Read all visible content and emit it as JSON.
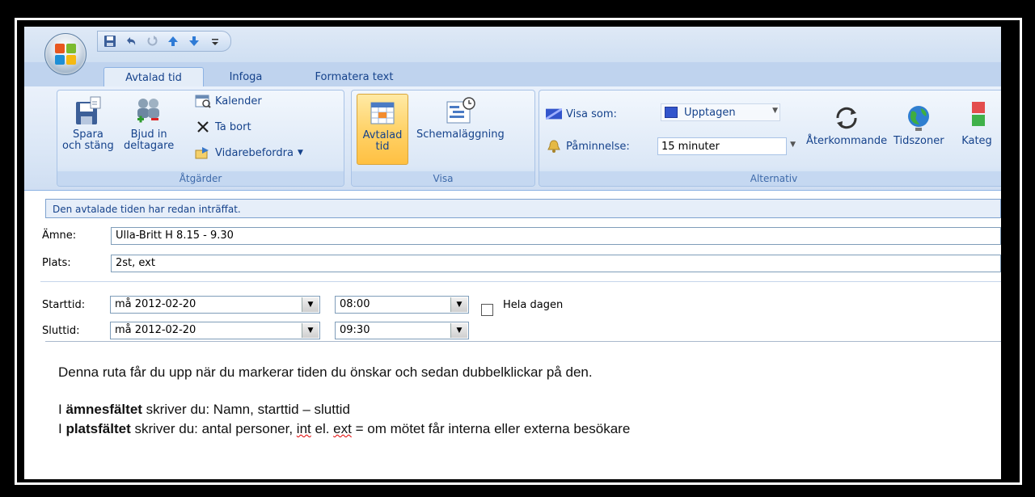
{
  "ribbon": {
    "tabs": [
      "Avtalad tid",
      "Infoga",
      "Formatera text"
    ],
    "groups": {
      "atgarder": {
        "label": "Åtgärder",
        "spara_line1": "Spara",
        "spara_line2": "och stäng",
        "bjud_line1": "Bjud in",
        "bjud_line2": "deltagare",
        "kalender": "Kalender",
        "ta_bort": "Ta bort",
        "vidarebefordra": "Vidarebefordra"
      },
      "visa": {
        "label": "Visa",
        "avtalad_line1": "Avtalad",
        "avtalad_line2": "tid",
        "schemalaggning": "Schemaläggning"
      },
      "alternativ": {
        "label": "Alternativ",
        "visa_som_label": "Visa som:",
        "visa_som_value": "Upptagen",
        "paminnelse_label": "Påminnelse:",
        "paminnelse_value": "15 minuter",
        "aterkommande": "Återkommande",
        "tidszoner": "Tidszoner",
        "kategorisera": "Kateg"
      }
    }
  },
  "form": {
    "info": "Den avtalade tiden har redan inträffat.",
    "amne_label": "Ämne:",
    "amne_value": "Ulla-Britt H 8.15 - 9.30",
    "plats_label": "Plats:",
    "plats_value": "2st, ext",
    "starttid_label": "Starttid:",
    "start_date": "må 2012-02-20",
    "start_time": "08:00",
    "hela_dagen": "Hela dagen",
    "sluttid_label": "Sluttid:",
    "end_date": "må 2012-02-20",
    "end_time": "09:30"
  },
  "body": {
    "line1": "Denna ruta får du upp när du markerar tiden du önskar och sedan dubbelklickar på den.",
    "line2_prefix": "I ",
    "line2_bold": "ämnesfältet",
    "line2_rest": " skriver du: Namn, starttid – sluttid",
    "line3_prefix": "I ",
    "line3_bold": "platsfältet",
    "line3_mid": " skriver du: antal personer, ",
    "line3_int": "int",
    "line3_el": " el. ",
    "line3_ext": "ext",
    "line3_end": " = om mötet får interna eller externa besökare"
  },
  "colors": {
    "ribbon_text": "#15428b",
    "group_label": "#3e6aaa",
    "active_button": "#ffd36a",
    "busy_blue": "#3355cc"
  }
}
